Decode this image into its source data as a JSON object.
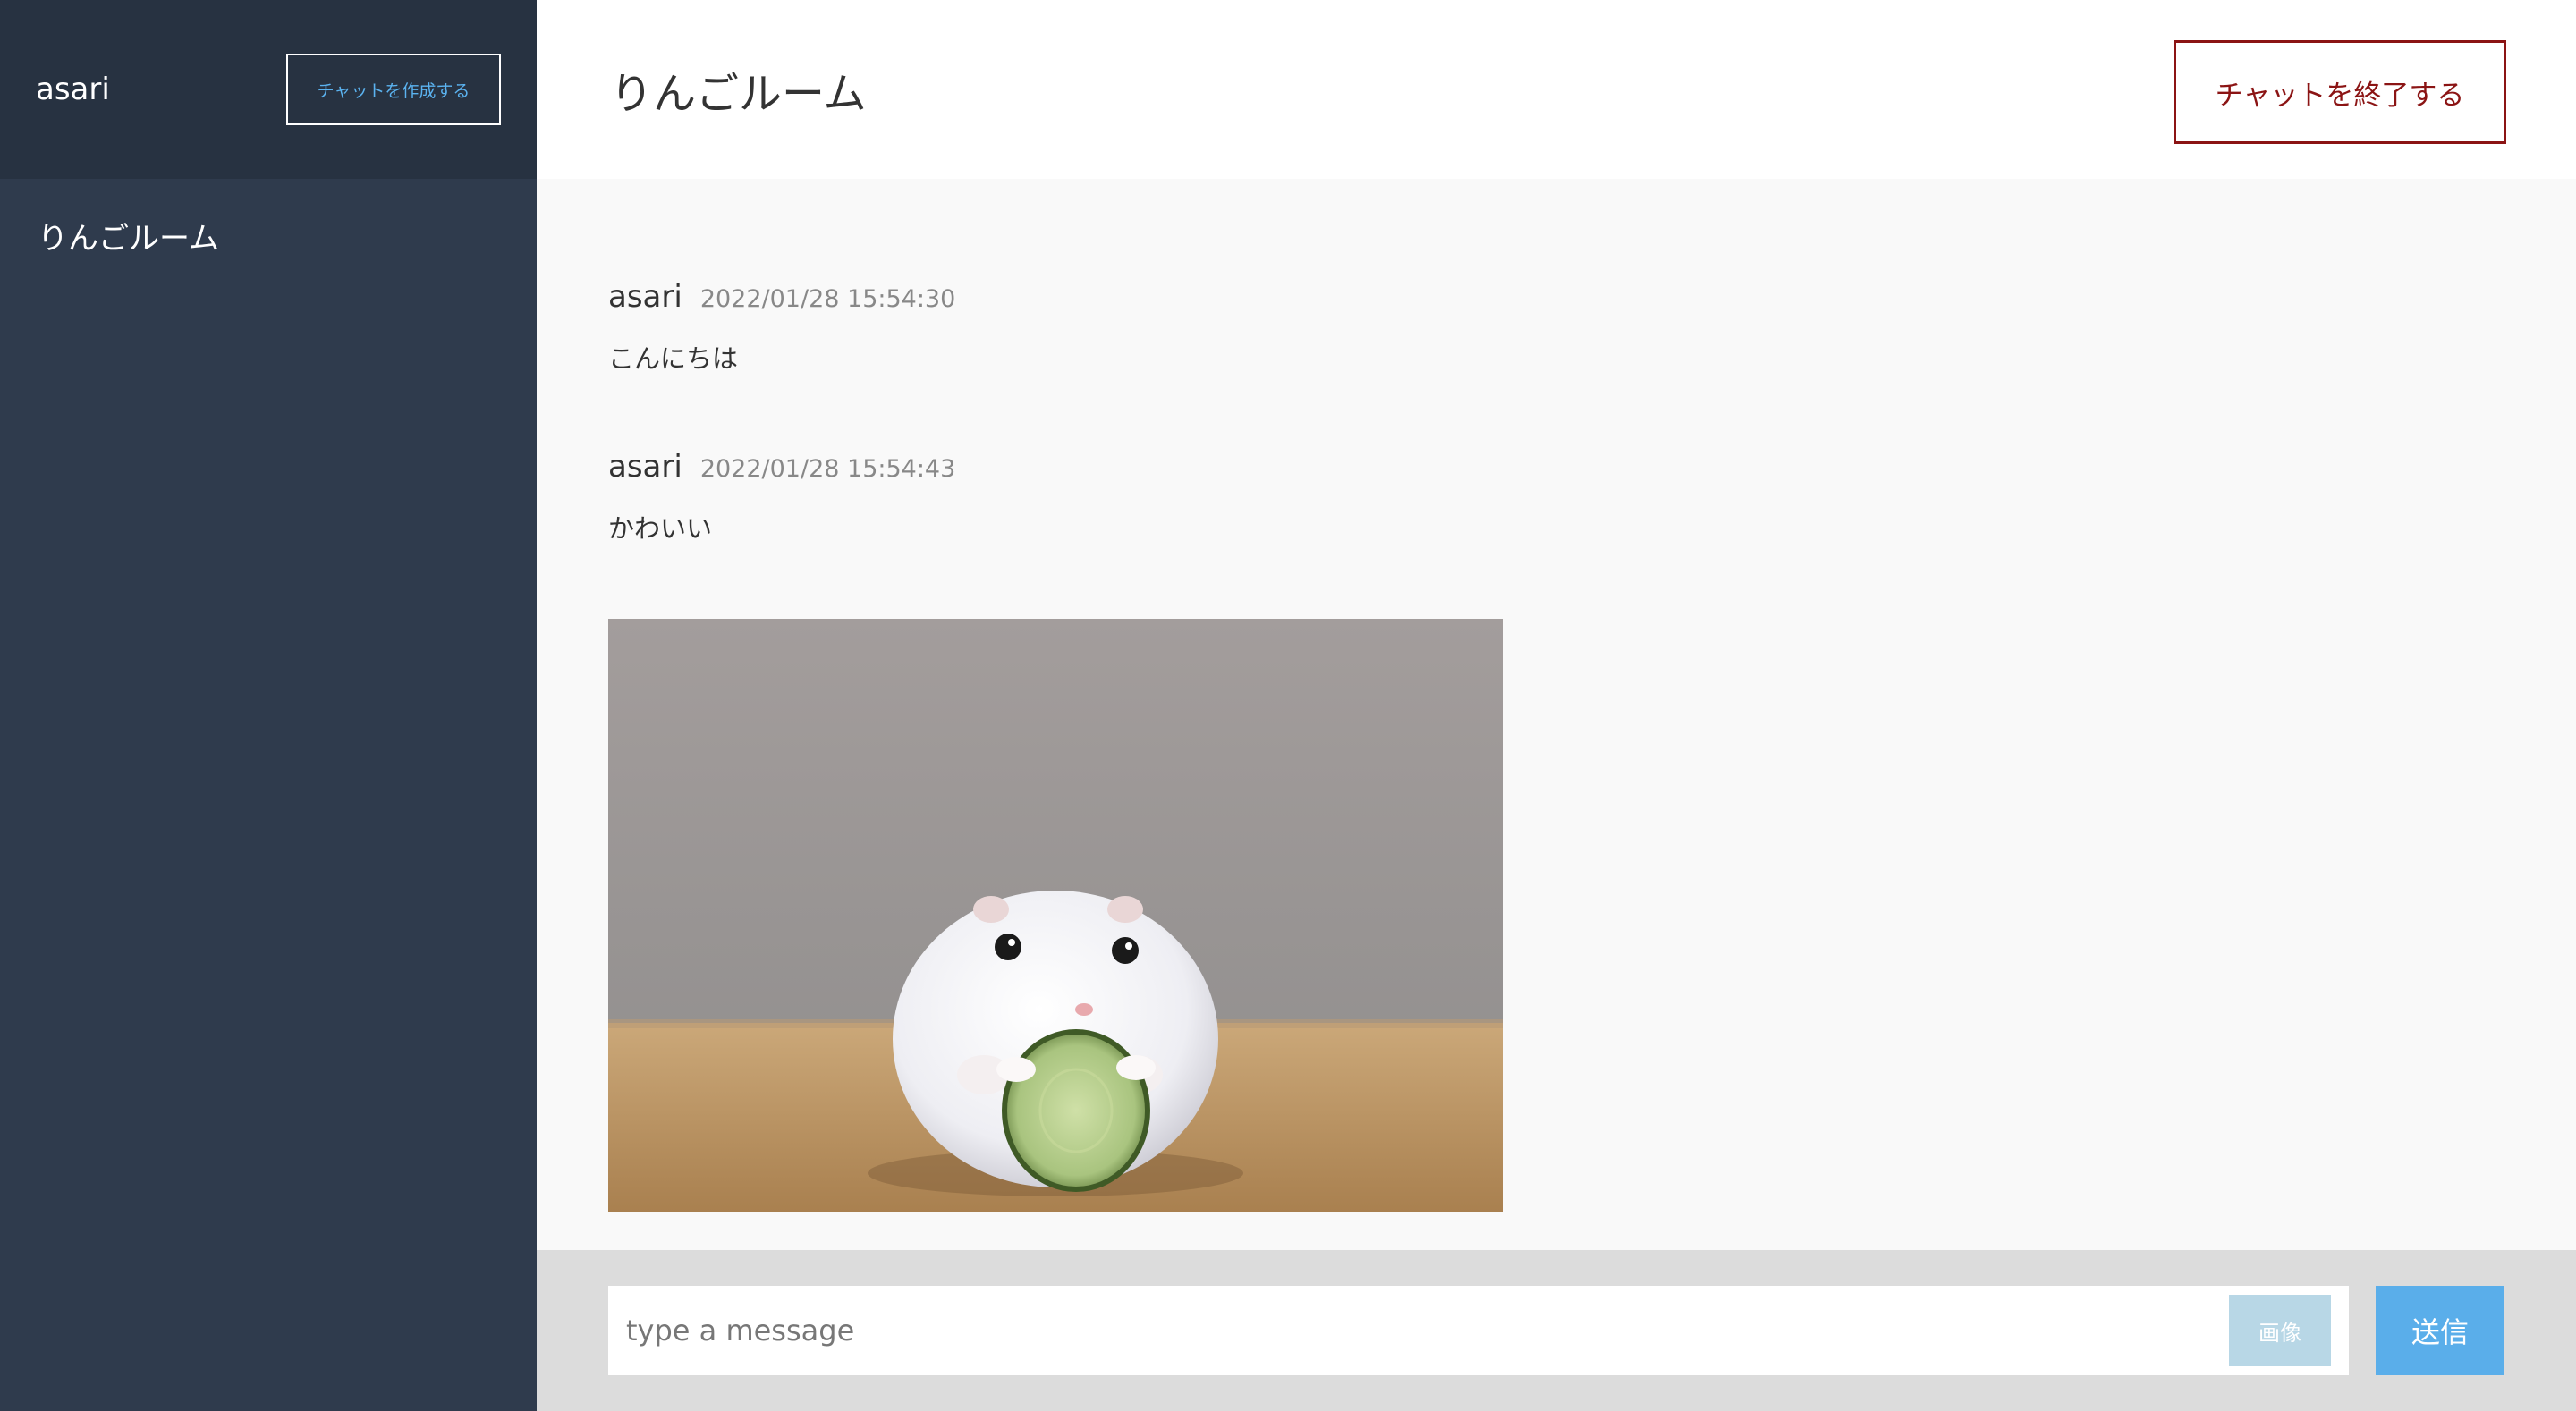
{
  "sidebar": {
    "user_name": "asari",
    "create_chat_label": "チャットを作成する",
    "rooms": [
      {
        "label": "りんごルーム"
      }
    ]
  },
  "header": {
    "room_title": "りんごルーム",
    "end_chat_label": "チャットを終了する"
  },
  "messages": [
    {
      "author": "asari",
      "timestamp": "2022/01/28 15:54:30",
      "text": "こんにちは"
    },
    {
      "author": "asari",
      "timestamp": "2022/01/28 15:54:43",
      "text": "かわいい"
    }
  ],
  "image_message": {
    "icon": "photo-hamster-eating-cucumber"
  },
  "composer": {
    "placeholder": "type a message",
    "value": "",
    "image_button_label": "画像",
    "send_button_label": "送信"
  },
  "colors": {
    "sidebar_bg": "#2f3b4d",
    "sidebar_header_bg": "#273241",
    "accent_blue": "#5aaeea",
    "end_chat_red": "#8b1414"
  }
}
